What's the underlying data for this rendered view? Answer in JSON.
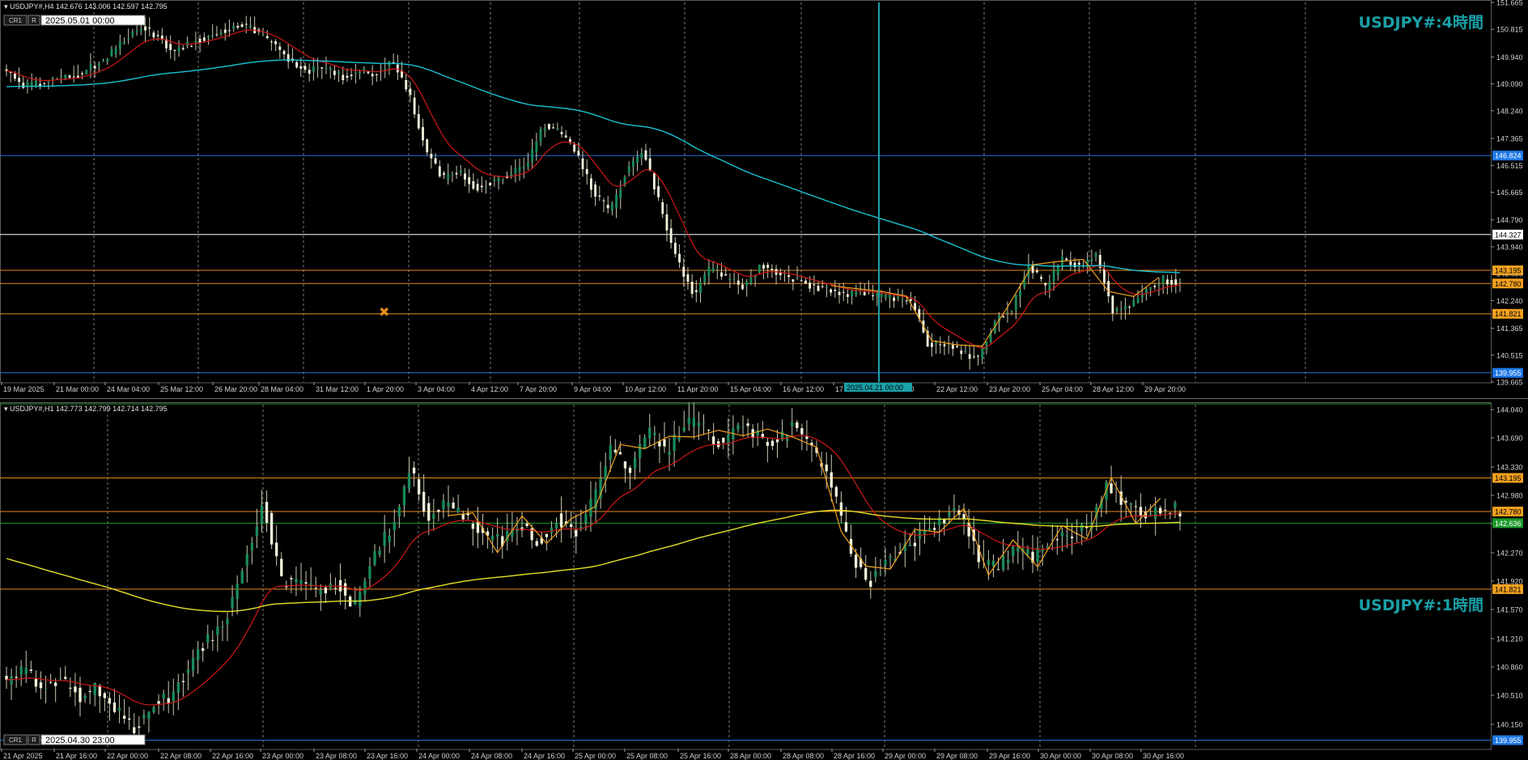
{
  "colors": {
    "background": "#000000",
    "bull_candle": "#1a8a5a",
    "bear_candle": "#f3f3dc",
    "wick": "#c8c8b0",
    "ma_red": "#d01818",
    "ma_cyan": "#19c2d2",
    "ma_yellow": "#e6e02a",
    "zigzag": "#f0a020",
    "hline_orange": "#e38a1c",
    "hline_blue": "#1e6fd0",
    "hline_white": "#ffffff",
    "hline_green": "#1a9a2a",
    "title_overlay": "#1aa0a8",
    "label_bg_orange": "#f0a020",
    "label_bg_blue": "#1e78e6",
    "label_bg_green": "#1a9a2a",
    "label_bg_white": "#ffffff"
  },
  "chart_data": [
    {
      "type": "candlestick",
      "symbol_header": "USDJPY#,H4  142.676 143.006 142.597 142.795",
      "overlay_title": "USDJPY#:4時間",
      "box_label_cr1": "CR1",
      "box_label_r": "R",
      "datetime_box": "2025.05.01 00:00",
      "crosshair_time_label": "2025.04.21 00:00",
      "ylim": [
        139.665,
        151.665
      ],
      "price_ticks": [
        "151.665",
        "150.815",
        "149.940",
        "149.090",
        "148.240",
        "147.365",
        "146.515",
        "145.665",
        "144.790",
        "143.940",
        "143.090",
        "142.240",
        "141.365",
        "140.515",
        "139.665"
      ],
      "time_ticks": [
        "19 Mar 2025",
        "21 Mar 00:00",
        "24 Mar 04:00",
        "25 Mar 12:00",
        "26 Mar 20:00",
        "28 Mar 04:00",
        "31 Mar 12:00",
        "1 Apr 20:00",
        "3 Apr 04:00",
        "4 Apr 12:00",
        "7 Apr 20:00",
        "9 Apr 04:00",
        "10 Apr 12:00",
        "11 Apr 20:00",
        "15 Apr 04:00",
        "16 Apr 12:00",
        "17",
        "04:00",
        "22 Apr 12:00",
        "23 Apr 20:00",
        "25 Apr 04:00",
        "28 Apr 12:00",
        "29 Apr 20:00"
      ],
      "horizontal_lines": [
        {
          "price": 146.824,
          "label": "146.824",
          "style": "blue"
        },
        {
          "price": 144.327,
          "label": "144.327",
          "style": "white"
        },
        {
          "price": 143.195,
          "label": "143.195",
          "style": "orange"
        },
        {
          "price": 142.78,
          "label": "142.780",
          "style": "orange"
        },
        {
          "price": 141.821,
          "label": "141.821",
          "style": "orange"
        },
        {
          "price": 139.955,
          "label": "139.955",
          "style": "blue"
        }
      ],
      "path_nodes": [
        149.5,
        149.0,
        149.1,
        149.3,
        149.3,
        149.6,
        149.9,
        150.5,
        150.9,
        150.6,
        150.1,
        150.4,
        150.6,
        150.8,
        151.0,
        150.7,
        150.3,
        149.8,
        149.5,
        149.6,
        149.3,
        149.5,
        149.4,
        149.8,
        148.8,
        147.0,
        146.1,
        146.3,
        145.8,
        146.0,
        146.2,
        146.5,
        147.8,
        147.6,
        146.9,
        145.7,
        145.0,
        146.4,
        147.0,
        145.2,
        143.5,
        142.4,
        143.3,
        142.9,
        142.7,
        143.4,
        143.1,
        142.9,
        142.7,
        142.6,
        142.4,
        142.5,
        142.4,
        142.3,
        142.2,
        140.8,
        140.9,
        140.6,
        140.4,
        141.6,
        142.0,
        143.4,
        142.6,
        143.6,
        143.3,
        143.7,
        141.9,
        142.1,
        142.6,
        142.9,
        142.8
      ]
    },
    {
      "type": "candlestick",
      "symbol_header": "USDJPY#,H1  142.773 142.799 142.714 142.795",
      "overlay_title": "USDJPY#:1時間",
      "box_label_cr1": "CR1",
      "box_label_r": "R",
      "datetime_box": "2025.04.30 23:00",
      "ylim": [
        139.85,
        144.1
      ],
      "price_ticks": [
        "144.040",
        "143.690",
        "143.330",
        "142.980",
        "142.630",
        "142.270",
        "141.920",
        "141.570",
        "141.210",
        "140.860",
        "140.510",
        "140.150"
      ],
      "time_ticks": [
        "21 Apr 2025",
        "21 Apr 16:00",
        "22 Apr 00:00",
        "22 Apr 08:00",
        "22 Apr 16:00",
        "23 Apr 00:00",
        "23 Apr 08:00",
        "23 Apr 16:00",
        "24 Apr 00:00",
        "24 Apr 08:00",
        "24 Apr 16:00",
        "25 Apr 00:00",
        "25 Apr 08:00",
        "25 Apr 16:00",
        "28 Apr 00:00",
        "28 Apr 08:00",
        "28 Apr 16:00",
        "29 Apr 00:00",
        "29 Apr 08:00",
        "29 Apr 16:00",
        "30 Apr 00:00",
        "30 Apr 08:00",
        "30 Apr 16:00"
      ],
      "horizontal_lines": [
        {
          "price": 143.195,
          "label": "143.195",
          "style": "orange"
        },
        {
          "price": 142.78,
          "label": "142.780",
          "style": "orange"
        },
        {
          "price": 142.636,
          "label": "142.636",
          "style": "green"
        },
        {
          "price": 141.821,
          "label": "141.821",
          "style": "orange"
        },
        {
          "price": 139.955,
          "label": "139.955",
          "style": "blue"
        }
      ],
      "path_nodes": [
        140.7,
        140.8,
        140.6,
        140.7,
        140.5,
        140.6,
        140.3,
        140.1,
        140.4,
        140.5,
        140.9,
        141.2,
        141.5,
        142.2,
        142.9,
        141.9,
        141.9,
        141.8,
        141.9,
        141.6,
        142.2,
        142.6,
        143.3,
        142.7,
        142.9,
        142.7,
        142.5,
        142.4,
        142.6,
        142.4,
        142.7,
        142.5,
        142.9,
        143.6,
        143.3,
        143.8,
        143.5,
        143.9,
        143.8,
        143.6,
        143.9,
        143.7,
        143.6,
        143.9,
        143.5,
        143.1,
        142.3,
        141.9,
        142.2,
        142.3,
        142.5,
        142.7,
        142.8,
        142.2,
        142.1,
        142.3,
        142.2,
        142.4,
        142.5,
        142.6,
        143.1,
        142.9,
        142.7,
        142.8,
        142.8
      ]
    }
  ]
}
